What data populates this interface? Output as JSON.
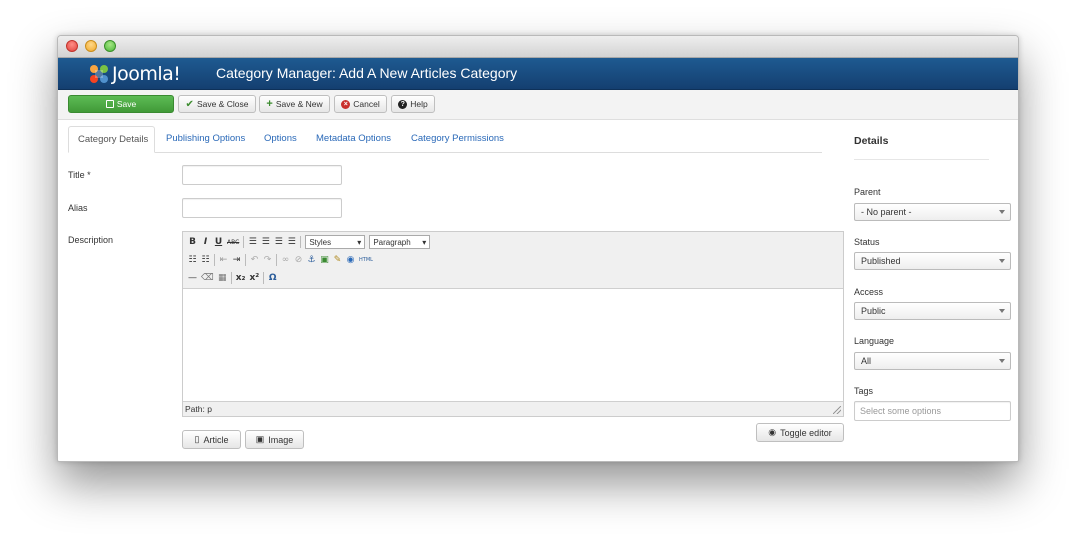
{
  "header": {
    "brand": "Joomla!",
    "title": "Category Manager: Add A New Articles Category"
  },
  "toolbar": {
    "save": "Save",
    "save_close": "Save & Close",
    "save_new": "Save & New",
    "cancel": "Cancel",
    "help": "Help"
  },
  "tabs": [
    "Category Details",
    "Publishing Options",
    "Options",
    "Metadata Options",
    "Category Permissions"
  ],
  "form": {
    "title_label": "Title *",
    "title_value": "",
    "alias_label": "Alias",
    "alias_value": "",
    "description_label": "Description"
  },
  "editor": {
    "styles_select": "Styles",
    "format_select": "Paragraph",
    "path": "Path: p",
    "html_label": "HTML"
  },
  "buttons": {
    "article": "Article",
    "image": "Image",
    "toggle_editor": "Toggle editor"
  },
  "details": {
    "heading": "Details",
    "parent_label": "Parent",
    "parent_value": "- No parent -",
    "status_label": "Status",
    "status_value": "Published",
    "access_label": "Access",
    "access_value": "Public",
    "language_label": "Language",
    "language_value": "All",
    "tags_label": "Tags",
    "tags_placeholder": "Select some options"
  },
  "colors": {
    "header_blue": "#1a4c82",
    "save_green": "#4caa43",
    "link_blue": "#2a69b8"
  }
}
